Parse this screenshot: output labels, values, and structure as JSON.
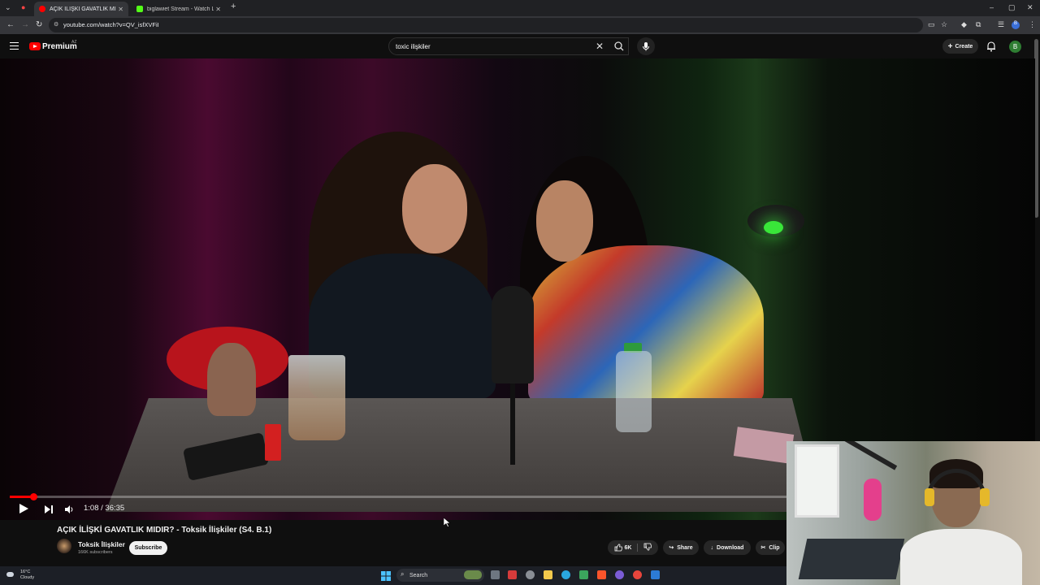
{
  "browser": {
    "tabs": [
      {
        "title": "AÇIK İLİŞKİ GAVATLIK MIDIR?",
        "active": true,
        "favicon_color": "#ff0000"
      },
      {
        "title": "biglawiet Stream - Watch Live",
        "active": false,
        "favicon_color": "#53fc18"
      }
    ],
    "url": "youtube.com/watch?v=QV_isfXVFiI",
    "new_tab_label": "+"
  },
  "youtube": {
    "logo_text": "Premium",
    "country_code": "AZ",
    "search_query": "toxic ilişkiler",
    "create_label": "Create",
    "avatar_letter": "B"
  },
  "player": {
    "current_time": "1:08",
    "duration": "36:35",
    "time_display": "1:08 / 36:35",
    "progress_fraction": 0.031
  },
  "video_info": {
    "title": "AÇIK İLİŞKİ GAVATLIK MIDIR? - Toksik İlişkiler (S4. B.1)",
    "channel_name": "Toksik İlişkiler",
    "subscribers": "166K subscribers",
    "subscribe_label": "Subscribe",
    "like_count": "6K",
    "share_label": "Share",
    "download_label": "Download",
    "clip_label": "Clip"
  },
  "taskbar": {
    "temperature": "16°C",
    "weather": "Cloudy",
    "search_label": "Search"
  },
  "colors": {
    "accent": "#ff0000",
    "background": "#0f0f0f",
    "surface": "#272727"
  }
}
